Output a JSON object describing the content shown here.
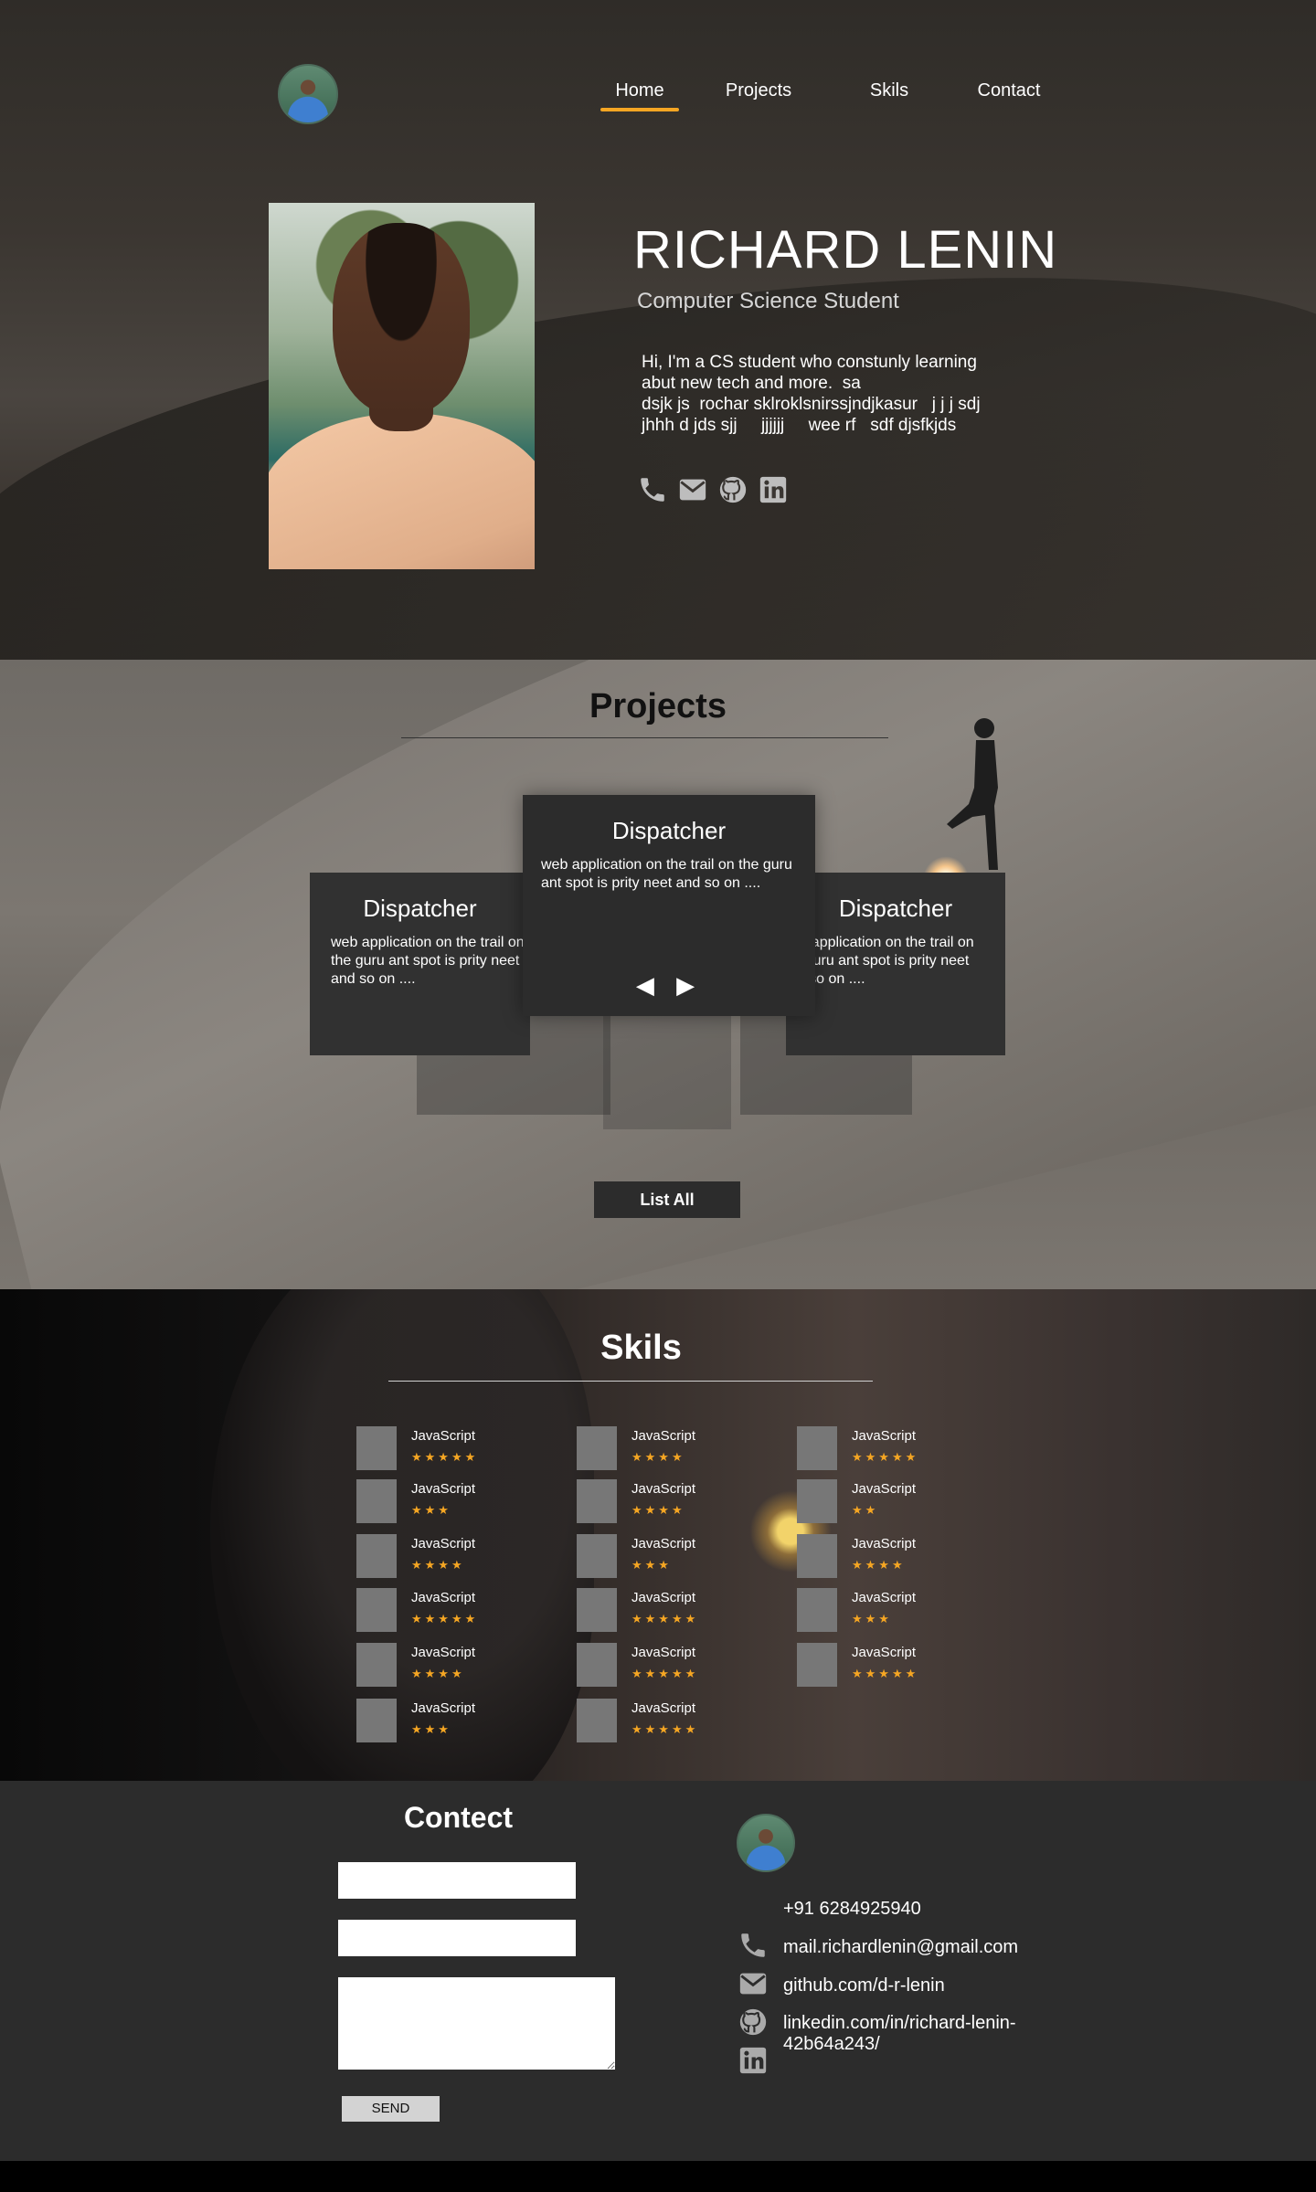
{
  "nav": {
    "items": [
      {
        "label": "Home",
        "active": true
      },
      {
        "label": "Projects"
      },
      {
        "label": "Skils"
      },
      {
        "label": "Contact"
      }
    ],
    "accent_color": "#f5a623"
  },
  "hero": {
    "name": "RICHARD LENIN",
    "role": "Computer Science Student",
    "bio": "Hi, I'm a CS student who constunly learning\nabut new tech and more.  sa\ndsjk js  rochar sklroklsnirssjndjkasur   j j j sdj\njhhh d jds sjj     jjjjjj     wee rf   sdf djsfkjds",
    "icons": [
      "phone-icon",
      "mail-icon",
      "github-icon",
      "linkedin-icon"
    ]
  },
  "projects": {
    "title": "Projects",
    "cards": [
      {
        "title": "Dispatcher",
        "desc": "web application on the trail on the guru ant spot is prity neet and so on ...."
      },
      {
        "title": "Dispatcher",
        "desc": "web application on the trail on the guru ant spot is prity neet and so on ...."
      },
      {
        "title": "Dispatcher",
        "desc": "web application on the trail on the guru ant spot is prity neet and so on ...."
      }
    ],
    "prev_arrow": "◀",
    "next_arrow": "▶",
    "list_all": "List All"
  },
  "skils": {
    "title": "Skils",
    "star_color": "#f5a623",
    "columns": [
      [
        {
          "name": "JavaScript",
          "stars": 5
        },
        {
          "name": "JavaScript",
          "stars": 3
        },
        {
          "name": "JavaScript",
          "stars": 4
        },
        {
          "name": "JavaScript",
          "stars": 5
        },
        {
          "name": "JavaScript",
          "stars": 4
        },
        {
          "name": "JavaScript",
          "stars": 3
        }
      ],
      [
        {
          "name": "JavaScript",
          "stars": 4
        },
        {
          "name": "JavaScript",
          "stars": 4
        },
        {
          "name": "JavaScript",
          "stars": 3
        },
        {
          "name": "JavaScript",
          "stars": 5
        },
        {
          "name": "JavaScript",
          "stars": 5
        },
        {
          "name": "JavaScript",
          "stars": 5
        }
      ],
      [
        {
          "name": "JavaScript",
          "stars": 5
        },
        {
          "name": "JavaScript",
          "stars": 2
        },
        {
          "name": "JavaScript",
          "stars": 4
        },
        {
          "name": "JavaScript",
          "stars": 3
        },
        {
          "name": "JavaScript",
          "stars": 5
        }
      ]
    ]
  },
  "contact": {
    "title": "Contect",
    "send_label": "SEND",
    "phone": "+91 6284925940",
    "email": "mail.richardlenin@gmail.com",
    "github": "github.com/d-r-lenin",
    "linkedin": "linkedin.com/in/richard-lenin-42b64a243/"
  }
}
